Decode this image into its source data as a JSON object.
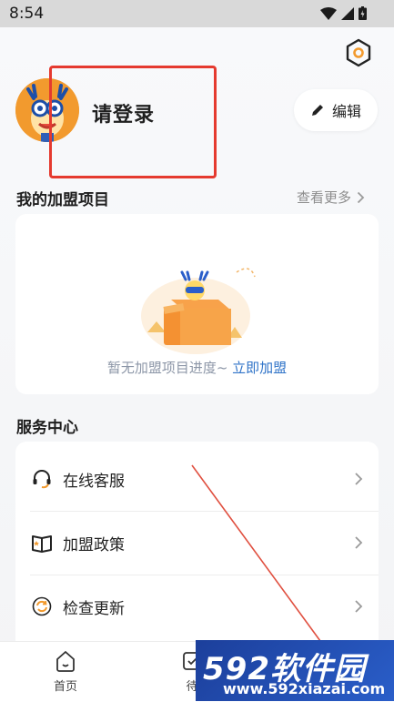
{
  "status_bar": {
    "time": "8:54"
  },
  "profile": {
    "login_text": "请登录",
    "edit_label": "编辑"
  },
  "franchise": {
    "title": "我的加盟项目",
    "more_label": "查看更多",
    "empty_text": "暂无加盟项目进度~",
    "empty_link": "立即加盟"
  },
  "service_center": {
    "title": "服务中心",
    "items": [
      {
        "label": "在线客服",
        "icon": "headset-icon"
      },
      {
        "label": "加盟政策",
        "icon": "policy-book-icon"
      },
      {
        "label": "检查更新",
        "icon": "refresh-icon"
      }
    ]
  },
  "tabbar": {
    "tabs": [
      {
        "label": "首页",
        "icon": "home-icon"
      },
      {
        "label": "待",
        "icon": "todo-icon"
      }
    ]
  },
  "watermark": {
    "brand": "592软件园",
    "url": "www.592xiazai.com"
  },
  "colors": {
    "accent_orange": "#f29a2e",
    "link_blue": "#2f73c8",
    "annotation_red": "#e53a2f",
    "watermark_blue": "#2a5ec9"
  }
}
